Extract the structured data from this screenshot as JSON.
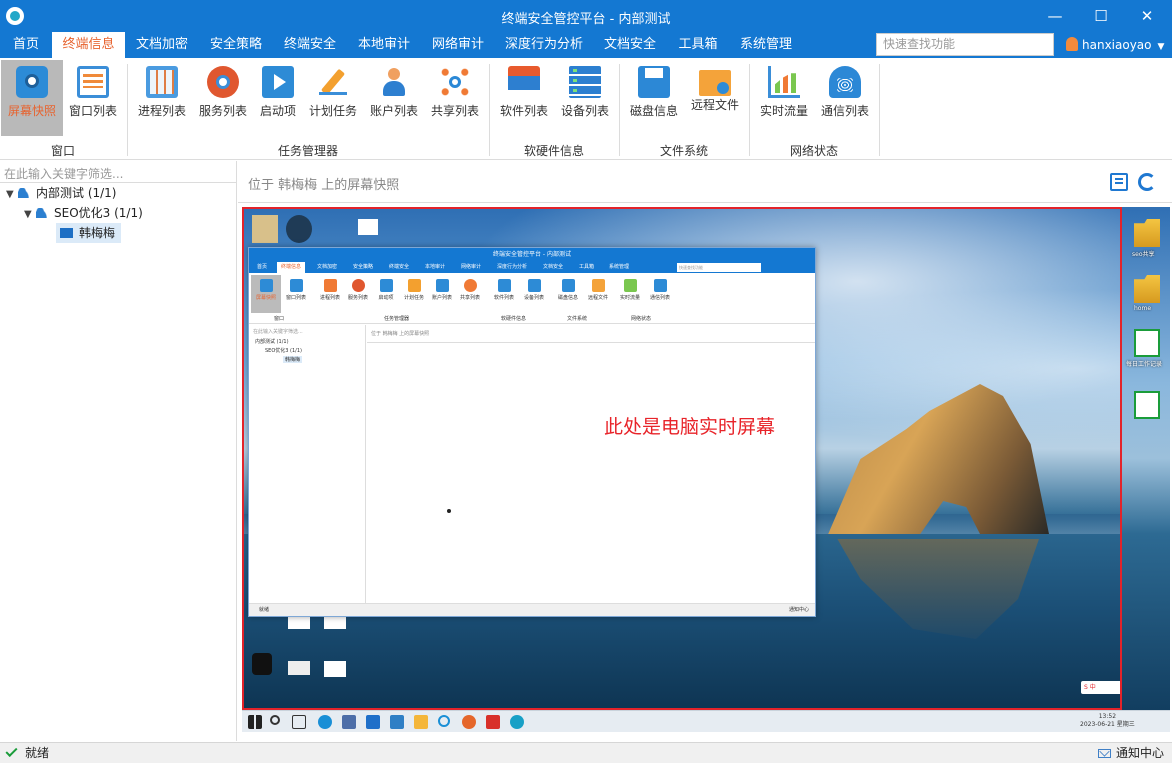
{
  "window": {
    "title": "终端安全管控平台 - 内部测试",
    "minimize_glyph": "—",
    "maximize_glyph": "☐",
    "close_glyph": "✕"
  },
  "menu": {
    "items": [
      "首页",
      "终端信息",
      "文档加密",
      "安全策略",
      "终端安全",
      "本地审计",
      "网络审计",
      "深度行为分析",
      "文档安全",
      "工具箱",
      "系统管理"
    ],
    "active": "终端信息",
    "search_placeholder": "快速查找功能",
    "user": "hanxiaoyao"
  },
  "ribbon": {
    "groups": [
      {
        "label": "窗口",
        "buttons": [
          "屏幕快照",
          "窗口列表"
        ]
      },
      {
        "label": "任务管理器",
        "buttons": [
          "进程列表",
          "服务列表",
          "启动项",
          "计划任务",
          "账户列表",
          "共享列表"
        ]
      },
      {
        "label": "软硬件信息",
        "buttons": [
          "软件列表",
          "设备列表"
        ]
      },
      {
        "label": "文件系统",
        "buttons": [
          "磁盘信息",
          "远程文件"
        ]
      },
      {
        "label": "网络状态",
        "buttons": [
          "实时流量",
          "通信列表"
        ]
      }
    ],
    "active_button": "屏幕快照"
  },
  "left_panel": {
    "filter_placeholder": "在此输入关键字筛选...",
    "tree": {
      "root": "内部测试 (1/1)",
      "group": "SEO优化3 (1/1)",
      "host": "韩梅梅"
    }
  },
  "content": {
    "location": "位于 韩梅梅 上的屏幕快照",
    "caption": "此处是电脑实时屏幕"
  },
  "remote_screen": {
    "mini_title": "终端安全管控平台 - 内部测试",
    "mini_search": "快速查找功能",
    "mini_tree": [
      "在此输入关键字筛选...",
      "内部测试 (1/1)",
      "SEO优化3 (1/1)",
      "韩梅梅"
    ],
    "mini_location": "位于 韩梅梅 上的屏幕快照",
    "mini_status": "就绪",
    "mini_notify": "通知中心",
    "right_desktop_icons": [
      "seo共享",
      "home",
      "每日工作记录"
    ],
    "ime": "S 中",
    "clock_time": "13:52",
    "clock_date": "2023-06-21 星期三"
  },
  "status_bar": {
    "status": "就绪",
    "notify": "通知中心"
  },
  "colors": {
    "titlebar": "#1478d2",
    "accent_active": "#e7632f",
    "frame_border": "#e3232a"
  }
}
